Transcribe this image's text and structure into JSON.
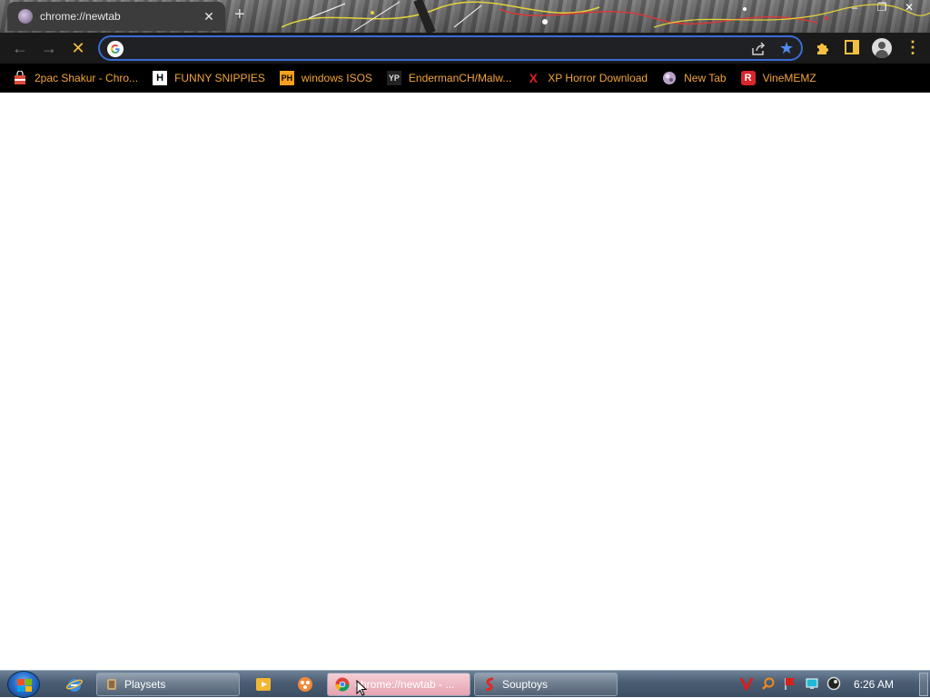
{
  "browser": {
    "tab": {
      "title": "chrome://newtab",
      "close_glyph": "✕"
    },
    "new_tab_glyph": "+",
    "window_controls": {
      "minimize": "–",
      "restore": "❐",
      "close": "✕"
    },
    "toolbar": {
      "back_glyph": "←",
      "forward_glyph": "→",
      "reload_glyph": "✕",
      "omnibox": {
        "value": "",
        "placeholder": ""
      },
      "star_glyph": "★",
      "menu_glyph": "⋮"
    },
    "bookmarks": [
      {
        "label": "2pac Shakur - Chro...",
        "icon": "shopping-bag-icon",
        "icon_color": "#e04a3a",
        "icon_text": ""
      },
      {
        "label": "FUNNY SNIPPIES",
        "icon": "h-logo-icon",
        "icon_color": "#ffffff",
        "icon_text": "H"
      },
      {
        "label": "windows ISOS",
        "icon": "ph-logo-icon",
        "icon_color": "#f7a11a",
        "icon_text": "PH"
      },
      {
        "label": "EndermanCH/Malw...",
        "icon": "yp-logo-icon",
        "icon_color": "#444444",
        "icon_text": "YP"
      },
      {
        "label": "XP Horror Download",
        "icon": "red-x-icon",
        "icon_color": "#e02020",
        "icon_text": "X"
      },
      {
        "label": "New Tab",
        "icon": "globe-icon",
        "icon_color": "#b9a3c8",
        "icon_text": ""
      },
      {
        "label": "VineMEMZ",
        "icon": "r-logo-icon",
        "icon_color": "#d9262b",
        "icon_text": "R"
      }
    ],
    "accent_color": "#f3a53b"
  },
  "taskbar": {
    "buttons": [
      {
        "label": "Playsets",
        "icon": "playsets-icon",
        "active": false
      },
      {
        "label": "chrome://newtab - ...",
        "icon": "chrome-icon",
        "active": true
      },
      {
        "label": "Souptoys",
        "icon": "souptoys-icon",
        "active": false
      }
    ],
    "clock": "6:26 AM"
  }
}
